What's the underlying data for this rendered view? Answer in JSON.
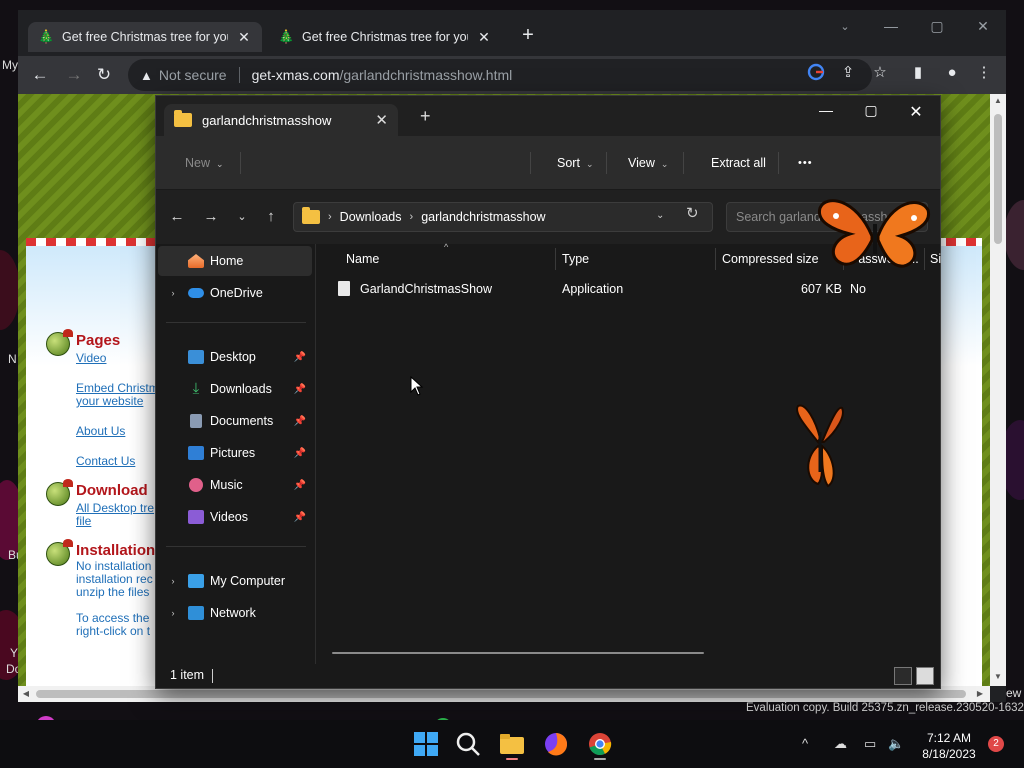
{
  "browser": {
    "tabs": [
      {
        "title": "Get free Christmas tree for your d",
        "active": true
      },
      {
        "title": "Get free Christmas tree for your d",
        "active": false
      }
    ],
    "new_tab": "+",
    "security": "Not secure",
    "url_host": "get-xmas.com",
    "url_path": "/garlandchristmasshow.html"
  },
  "website": {
    "sections": [
      {
        "heading": "Pages",
        "links": [
          "Video",
          "Embed Christm",
          "your website",
          "About Us",
          "Contact Us"
        ]
      },
      {
        "heading": "Download",
        "links": [
          "All Desktop tre",
          "file"
        ]
      },
      {
        "heading": "Installation",
        "text": [
          "No installation",
          "installation rec",
          "unzip the files",
          "To access the",
          "right-click on t"
        ]
      }
    ]
  },
  "explorer": {
    "tab_title": "garlandchristmasshow",
    "commands": {
      "new": "New",
      "sort": "Sort",
      "view": "View",
      "extract": "Extract all",
      "more": "•••"
    },
    "breadcrumb": [
      "Downloads",
      "garlandchristmasshow"
    ],
    "search_placeholder": "Search garlandchristmasshow",
    "nav": [
      {
        "label": "Home"
      },
      {
        "label": "OneDrive"
      },
      {
        "label": "Desktop"
      },
      {
        "label": "Downloads"
      },
      {
        "label": "Documents"
      },
      {
        "label": "Pictures"
      },
      {
        "label": "Music"
      },
      {
        "label": "Videos"
      },
      {
        "label": "My Computer"
      },
      {
        "label": "Network"
      }
    ],
    "columns": [
      "Name",
      "Type",
      "Compressed size",
      "Password ...",
      "Si"
    ],
    "files": [
      {
        "name": "GarlandChristmasShow",
        "type": "Application",
        "size": "607 KB",
        "password": "No"
      }
    ],
    "status": "1 item"
  },
  "taskbar": {
    "time": "7:12 AM",
    "date": "8/18/2023",
    "badge": "2"
  },
  "eval_copy": "Evaluation copy. Build 25375.zn_release.230520-1632",
  "desktop_fragments": [
    "My",
    "N",
    "Bu",
    "Y",
    "Do",
    "ew"
  ]
}
